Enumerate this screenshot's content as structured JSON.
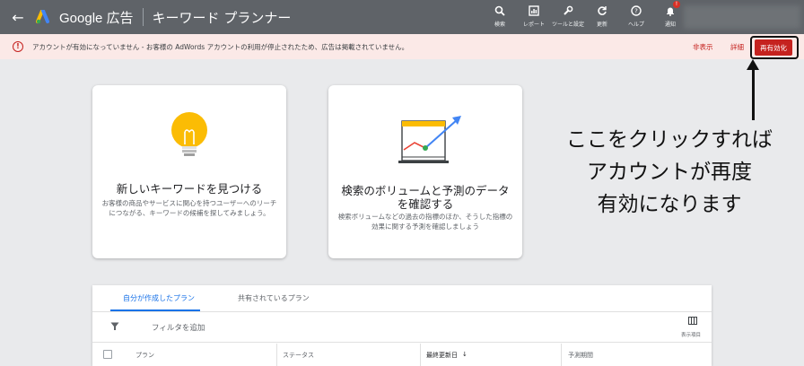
{
  "topbar": {
    "back_icon": "arrow-left-icon",
    "brand": "Google 広告",
    "page_title": "キーワード プランナー",
    "tools": [
      {
        "icon": "search-icon",
        "label": "検索"
      },
      {
        "icon": "report-icon",
        "label": "レポート"
      },
      {
        "icon": "wrench-icon",
        "label": "ツールと設定"
      },
      {
        "icon": "refresh-icon",
        "label": "更新"
      },
      {
        "icon": "help-icon",
        "label": "ヘルプ"
      },
      {
        "icon": "bell-icon",
        "label": "通知",
        "badge": "!"
      }
    ]
  },
  "alert": {
    "icon": "alert-circle-icon",
    "text": "アカウントが有効になっていません - お客様の AdWords アカウントの利用が停止されたため、広告は掲載されていません。",
    "hide_label": "非表示",
    "detail_label": "詳細",
    "reactivate_label": "再有効化"
  },
  "cards": [
    {
      "icon": "lightbulb-icon",
      "title": "新しいキーワードを見つける",
      "desc": "お客様の商品やサービスに関心を持つユーザーへのリーチにつながる、キーワードの候補を探してみましょう。"
    },
    {
      "icon": "trend-chart-icon",
      "title": "検索のボリュームと予測のデータを確認する",
      "desc": "検索ボリュームなどの過去の指標のほか、そうした指標の効果に関する予測を確認しましょう"
    }
  ],
  "annotation": {
    "lines": [
      "ここをクリックすれば",
      "アカウントが再度",
      "有効になります"
    ]
  },
  "plans": {
    "tabs": [
      "自分が作成したプラン",
      "共有されているプラン"
    ],
    "filter_placeholder": "フィルタを追加",
    "columns_label": "表示項目",
    "columns": [
      "プラン",
      "ステータス",
      "最終更新日",
      "予測期間"
    ],
    "sort_indicator": "↓"
  },
  "colors": {
    "topbar": "#5f6368",
    "alert_bg": "#fbe9e7",
    "danger": "#c5221f",
    "accent": "#1a73e8"
  }
}
